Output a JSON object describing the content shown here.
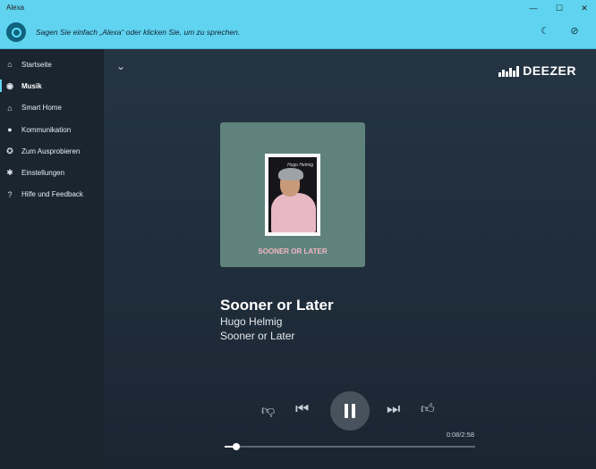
{
  "window": {
    "title": "Alexa",
    "minimize": "—",
    "maximize": "☐",
    "close": "✕"
  },
  "topbar": {
    "prompt": "Sagen Sie einfach „Alexa“ oder klicken Sie, um zu sprechen."
  },
  "sidebar": {
    "items": [
      {
        "label": "Startseite",
        "icon": "home-icon",
        "glyph": "⌂"
      },
      {
        "label": "Musik",
        "icon": "music-icon",
        "glyph": "◉"
      },
      {
        "label": "Smart Home",
        "icon": "smart-home-icon",
        "glyph": "⌂"
      },
      {
        "label": "Kommunikation",
        "icon": "chat-icon",
        "glyph": "●"
      },
      {
        "label": "Zum Ausprobieren",
        "icon": "compass-icon",
        "glyph": "✪"
      },
      {
        "label": "Einstellungen",
        "icon": "gear-icon",
        "glyph": "✱"
      },
      {
        "label": "Hilfe und Feedback",
        "icon": "help-icon",
        "glyph": "?"
      }
    ],
    "active_index": 1
  },
  "player": {
    "provider": "DEEZER",
    "album_text": "SOONER OR LATER",
    "signature": "Hugo Helmig",
    "track_title": "Sooner or Later",
    "artist": "Hugo Helmig",
    "album": "Sooner or Later",
    "time": "0:08/2:58",
    "progress": 0.045
  },
  "colors": {
    "accent": "#5fd3ef",
    "album_bg": "#5f837c",
    "album_text": "#f4b7c4"
  }
}
